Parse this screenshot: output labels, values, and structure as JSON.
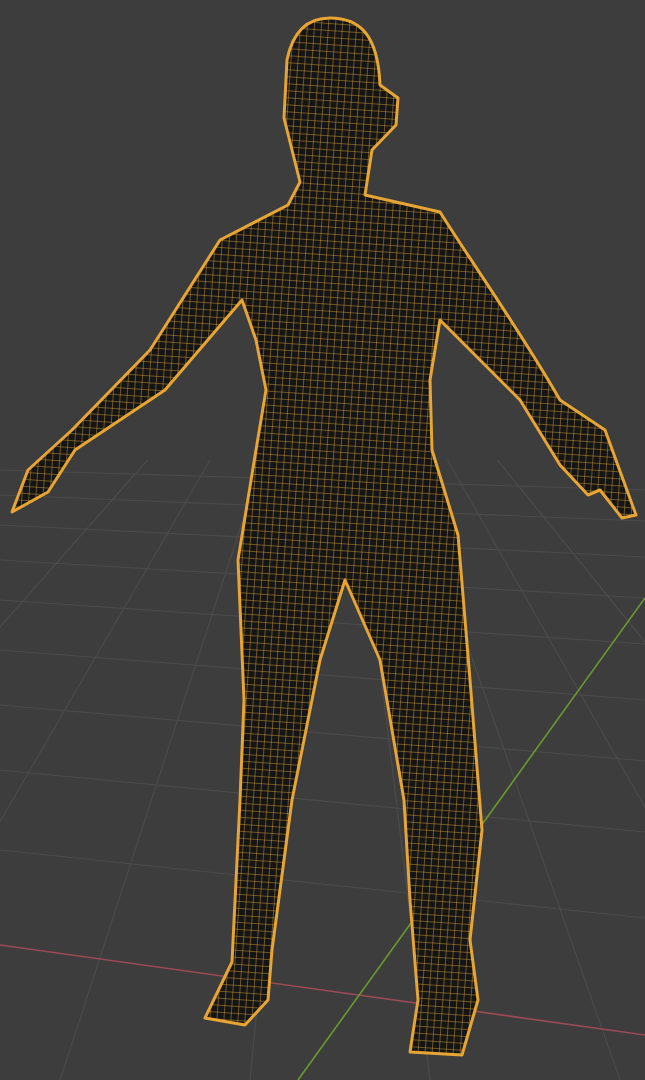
{
  "viewport": {
    "axes": [
      {
        "kind": "x",
        "color": "#9a4a55"
      },
      {
        "kind": "y",
        "color": "#6a9a2e"
      }
    ],
    "mesh": {
      "selected": true
    }
  }
}
